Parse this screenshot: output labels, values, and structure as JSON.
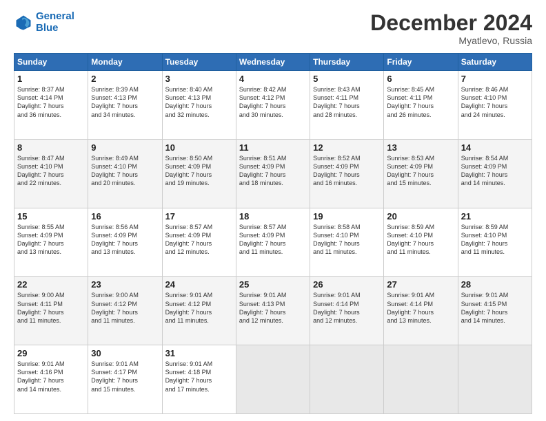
{
  "header": {
    "logo_line1": "General",
    "logo_line2": "Blue",
    "month_title": "December 2024",
    "subtitle": "Myatlevo, Russia"
  },
  "days_of_week": [
    "Sunday",
    "Monday",
    "Tuesday",
    "Wednesday",
    "Thursday",
    "Friday",
    "Saturday"
  ],
  "weeks": [
    [
      {
        "day": "1",
        "info": "Sunrise: 8:37 AM\nSunset: 4:14 PM\nDaylight: 7 hours\nand 36 minutes."
      },
      {
        "day": "2",
        "info": "Sunrise: 8:39 AM\nSunset: 4:13 PM\nDaylight: 7 hours\nand 34 minutes."
      },
      {
        "day": "3",
        "info": "Sunrise: 8:40 AM\nSunset: 4:13 PM\nDaylight: 7 hours\nand 32 minutes."
      },
      {
        "day": "4",
        "info": "Sunrise: 8:42 AM\nSunset: 4:12 PM\nDaylight: 7 hours\nand 30 minutes."
      },
      {
        "day": "5",
        "info": "Sunrise: 8:43 AM\nSunset: 4:11 PM\nDaylight: 7 hours\nand 28 minutes."
      },
      {
        "day": "6",
        "info": "Sunrise: 8:45 AM\nSunset: 4:11 PM\nDaylight: 7 hours\nand 26 minutes."
      },
      {
        "day": "7",
        "info": "Sunrise: 8:46 AM\nSunset: 4:10 PM\nDaylight: 7 hours\nand 24 minutes."
      }
    ],
    [
      {
        "day": "8",
        "info": "Sunrise: 8:47 AM\nSunset: 4:10 PM\nDaylight: 7 hours\nand 22 minutes."
      },
      {
        "day": "9",
        "info": "Sunrise: 8:49 AM\nSunset: 4:10 PM\nDaylight: 7 hours\nand 20 minutes."
      },
      {
        "day": "10",
        "info": "Sunrise: 8:50 AM\nSunset: 4:09 PM\nDaylight: 7 hours\nand 19 minutes."
      },
      {
        "day": "11",
        "info": "Sunrise: 8:51 AM\nSunset: 4:09 PM\nDaylight: 7 hours\nand 18 minutes."
      },
      {
        "day": "12",
        "info": "Sunrise: 8:52 AM\nSunset: 4:09 PM\nDaylight: 7 hours\nand 16 minutes."
      },
      {
        "day": "13",
        "info": "Sunrise: 8:53 AM\nSunset: 4:09 PM\nDaylight: 7 hours\nand 15 minutes."
      },
      {
        "day": "14",
        "info": "Sunrise: 8:54 AM\nSunset: 4:09 PM\nDaylight: 7 hours\nand 14 minutes."
      }
    ],
    [
      {
        "day": "15",
        "info": "Sunrise: 8:55 AM\nSunset: 4:09 PM\nDaylight: 7 hours\nand 13 minutes."
      },
      {
        "day": "16",
        "info": "Sunrise: 8:56 AM\nSunset: 4:09 PM\nDaylight: 7 hours\nand 13 minutes."
      },
      {
        "day": "17",
        "info": "Sunrise: 8:57 AM\nSunset: 4:09 PM\nDaylight: 7 hours\nand 12 minutes."
      },
      {
        "day": "18",
        "info": "Sunrise: 8:57 AM\nSunset: 4:09 PM\nDaylight: 7 hours\nand 11 minutes."
      },
      {
        "day": "19",
        "info": "Sunrise: 8:58 AM\nSunset: 4:10 PM\nDaylight: 7 hours\nand 11 minutes."
      },
      {
        "day": "20",
        "info": "Sunrise: 8:59 AM\nSunset: 4:10 PM\nDaylight: 7 hours\nand 11 minutes."
      },
      {
        "day": "21",
        "info": "Sunrise: 8:59 AM\nSunset: 4:10 PM\nDaylight: 7 hours\nand 11 minutes."
      }
    ],
    [
      {
        "day": "22",
        "info": "Sunrise: 9:00 AM\nSunset: 4:11 PM\nDaylight: 7 hours\nand 11 minutes."
      },
      {
        "day": "23",
        "info": "Sunrise: 9:00 AM\nSunset: 4:12 PM\nDaylight: 7 hours\nand 11 minutes."
      },
      {
        "day": "24",
        "info": "Sunrise: 9:01 AM\nSunset: 4:12 PM\nDaylight: 7 hours\nand 11 minutes."
      },
      {
        "day": "25",
        "info": "Sunrise: 9:01 AM\nSunset: 4:13 PM\nDaylight: 7 hours\nand 12 minutes."
      },
      {
        "day": "26",
        "info": "Sunrise: 9:01 AM\nSunset: 4:14 PM\nDaylight: 7 hours\nand 12 minutes."
      },
      {
        "day": "27",
        "info": "Sunrise: 9:01 AM\nSunset: 4:14 PM\nDaylight: 7 hours\nand 13 minutes."
      },
      {
        "day": "28",
        "info": "Sunrise: 9:01 AM\nSunset: 4:15 PM\nDaylight: 7 hours\nand 14 minutes."
      }
    ],
    [
      {
        "day": "29",
        "info": "Sunrise: 9:01 AM\nSunset: 4:16 PM\nDaylight: 7 hours\nand 14 minutes."
      },
      {
        "day": "30",
        "info": "Sunrise: 9:01 AM\nSunset: 4:17 PM\nDaylight: 7 hours\nand 15 minutes."
      },
      {
        "day": "31",
        "info": "Sunrise: 9:01 AM\nSunset: 4:18 PM\nDaylight: 7 hours\nand 17 minutes."
      },
      {
        "day": "",
        "info": ""
      },
      {
        "day": "",
        "info": ""
      },
      {
        "day": "",
        "info": ""
      },
      {
        "day": "",
        "info": ""
      }
    ]
  ]
}
